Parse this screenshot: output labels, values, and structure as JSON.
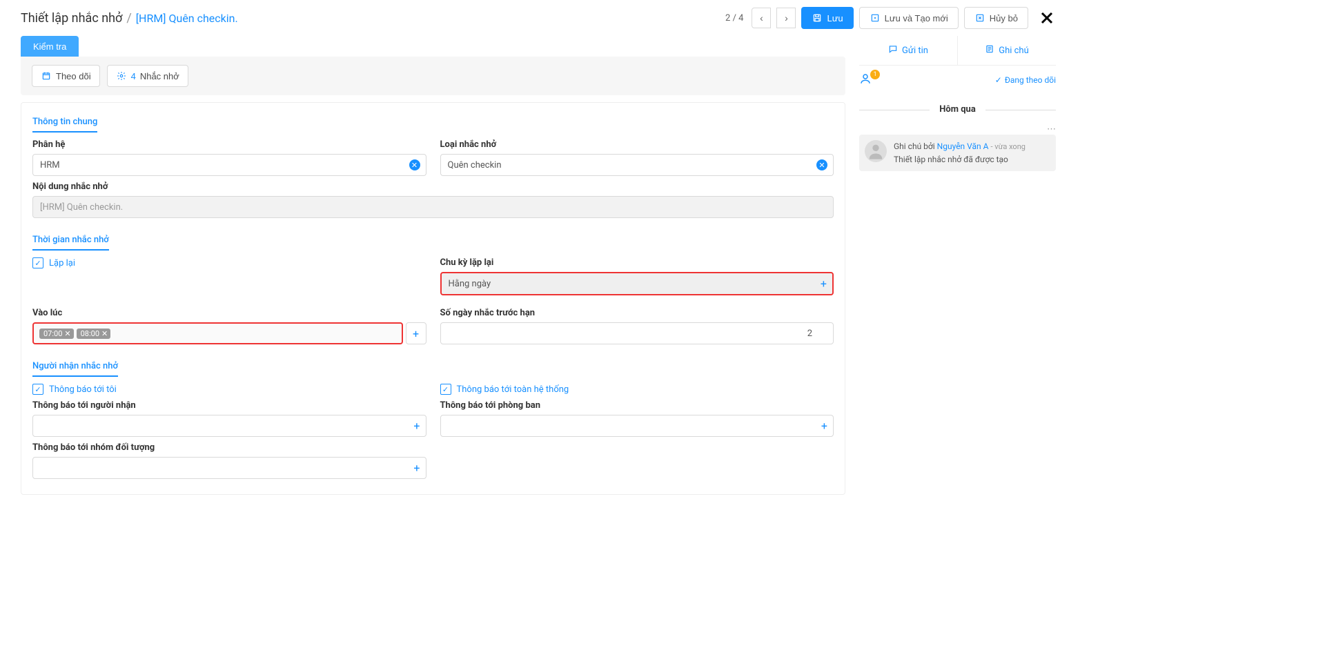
{
  "header": {
    "title": "Thiết lập nhắc nhở",
    "subtitle": "[HRM] Quên checkin.",
    "pager": {
      "current": "2",
      "total": "4"
    },
    "save_label": "Lưu",
    "save_new_label": "Lưu và Tạo mới",
    "cancel_label": "Hủy bỏ"
  },
  "toolbar": {
    "check_label": "Kiểm tra",
    "follow_label": "Theo dõi",
    "reminder_count": "4",
    "reminder_label": "Nhắc nhở"
  },
  "form": {
    "section_general": "Thông tin chung",
    "subsystem_label": "Phân hệ",
    "subsystem_value": "HRM",
    "reminder_type_label": "Loại nhắc nhở",
    "reminder_type_value": "Quên checkin",
    "content_label": "Nội dung nhắc nhở",
    "content_value": "[HRM] Quên checkin.",
    "section_time": "Thời gian nhắc nhở",
    "repeat_label": "Lặp lại",
    "cycle_label": "Chu kỳ lặp lại",
    "cycle_value": "Hằng ngày",
    "at_time_label": "Vào lúc",
    "at_times": [
      "07:00",
      "08:00"
    ],
    "days_before_label": "Số ngày nhắc trước hạn",
    "days_before_value": "2",
    "section_recipients": "Người nhận nhắc nhở",
    "notify_me_label": "Thông báo tới tôi",
    "notify_all_label": "Thông báo tới toàn hệ thống",
    "notify_recipients_label": "Thông báo tới người nhận",
    "notify_dept_label": "Thông báo tới phòng ban",
    "notify_group_label": "Thông báo tới nhóm đối tượng"
  },
  "sidebar": {
    "send_msg_label": "Gửi tin",
    "note_label": "Ghi chú",
    "follower_count": "1",
    "following_label": "Đang theo dõi",
    "divider_yesterday": "Hôm qua",
    "log": {
      "prefix": "Ghi chú bởi",
      "user": "Nguyễn Văn A",
      "time_meta": "- vừa xong",
      "body": "Thiết lập nhắc nhở đã được tạo"
    }
  }
}
